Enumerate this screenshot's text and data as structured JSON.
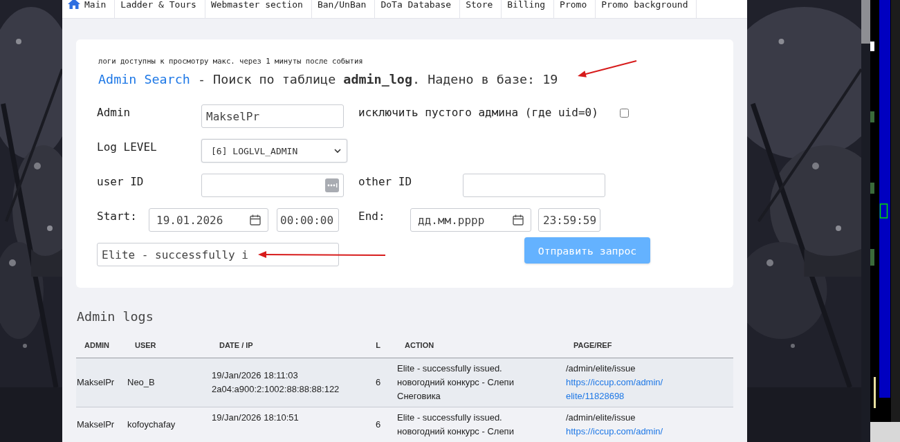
{
  "nav": {
    "items": [
      {
        "label": "Main",
        "kind": "home"
      },
      {
        "label": "Ladder & Tours",
        "kind": "text"
      },
      {
        "label": "Webmaster section",
        "kind": "text"
      },
      {
        "label": "Ban/UnBan",
        "kind": "text"
      },
      {
        "label": "DoTa Database",
        "kind": "text"
      },
      {
        "label": "Store",
        "kind": "text"
      },
      {
        "label": "Billing",
        "kind": "text"
      },
      {
        "label": "Promo",
        "kind": "text"
      },
      {
        "label": "Promo background",
        "kind": "text"
      }
    ]
  },
  "search_card": {
    "note": "логи доступны к просмотру макс. через 1 минуты после события",
    "heading": {
      "link": "Admin Search",
      "text": " - Поиск по таблице **admin_log**. Надено в базе: 19"
    },
    "admin": {
      "label": "Admin",
      "value": "MakselPr"
    },
    "exclude_empty_admin": {
      "label": "исключить пустого админа (где uid=0)",
      "checked": false
    },
    "log_level": {
      "label": "Log LEVEL",
      "value": "[6] LOGLVL_ADMIN"
    },
    "user_id": {
      "label": "user ID"
    },
    "other_id": {
      "label": "other ID"
    },
    "start": {
      "label": "Start:",
      "date": "19.01.2026",
      "time": "00:00:00"
    },
    "end": {
      "label": "End:",
      "date_placeholder": "дд.мм.рррр",
      "time": "23:59:59"
    },
    "action_filter": {
      "value": "Elite - successfully i"
    },
    "submit": {
      "label": "Отправить запрос"
    }
  },
  "annotations": [
    {
      "kind": "arrow"
    },
    {
      "kind": "arrow"
    }
  ],
  "logs": {
    "title": "Admin logs",
    "columns": [
      "ADMIN",
      "USER",
      "DATE / IP",
      "L",
      "ACTION",
      "PAGE/REF"
    ],
    "rows": [
      {
        "admin": "MakselPr",
        "user": "Neo_B",
        "date": "19/Jan/2026 18:11:03",
        "ip": "2a04:a900:2:1002:88:88:88:122",
        "level": "6",
        "action": "Elite - successfully issued. новогодний конкурс - Слепи Снеговика",
        "page": "/admin/elite/issue",
        "ref": "https://iccup.com/admin/elite/11828698"
      },
      {
        "admin": "MakselPr",
        "user": "kofoychafay",
        "date": "19/Jan/2026 18:10:51",
        "level": "6",
        "action": "Elite - successfully issued. новогодний конкурс - Слепи",
        "page": "/admin/elite/issue",
        "ref": "https://iccup.com/admin/"
      }
    ]
  }
}
